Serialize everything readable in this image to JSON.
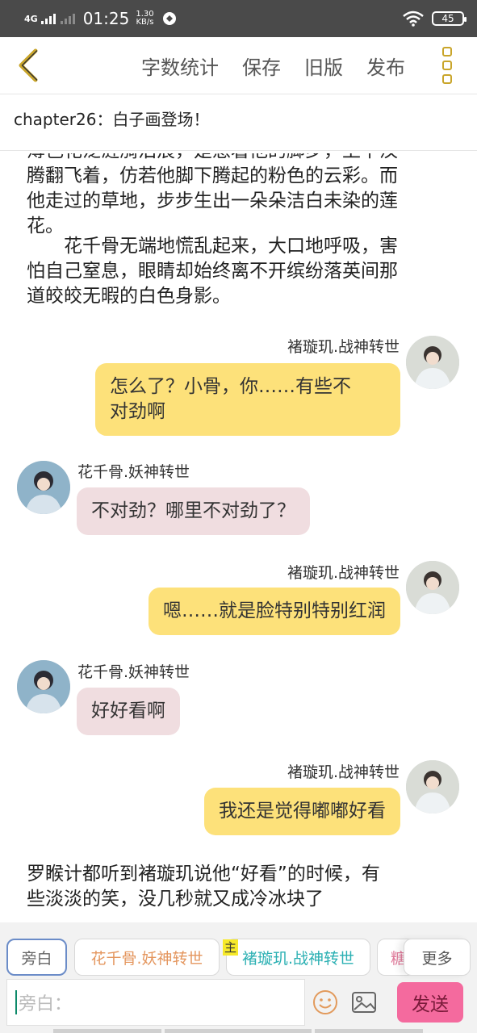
{
  "status_bar": {
    "network": "4G",
    "time": "01:25",
    "speed_value": "1.30",
    "speed_unit": "KB/s",
    "battery": "45"
  },
  "toolbar": {
    "word_count": "字数统计",
    "save": "保存",
    "old_version": "旧版",
    "publish": "发布",
    "back_icon": "chevron-left-icon",
    "more_icon": "more-vertical-icon"
  },
  "chapter": {
    "title": "chapter26：白子画登场！"
  },
  "story": {
    "para1_line1": "薄色花泛涟漪泪痕，是惹着他的脚步，上下汉",
    "para1_line2": "腾翻飞着，仿若他脚下腾起的粉色的云彩。而",
    "para1_line3": "他走过的草地，步步生出一朵朵洁白未染的莲",
    "para1_line4": "花。",
    "para2_line1": "　　花千骨无端地慌乱起来，大口地呼吸，害",
    "para2_line2": "怕自己窒息，眼睛却始终离不开缤纷落英间那",
    "para2_line3": "道皎皎无暇的白色身影。",
    "messages": [
      {
        "speaker": "褚璇玑.战神转世",
        "line1": "怎么了？小骨，你……有些不",
        "line2": "对劲啊"
      },
      {
        "speaker": "花千骨.妖神转世",
        "text": "不对劲？哪里不对劲了？"
      },
      {
        "speaker": "褚璇玑.战神转世",
        "text": "嗯……就是脸特别特别红润"
      },
      {
        "speaker": "花千骨.妖神转世",
        "text": "好好看啊"
      },
      {
        "speaker": "褚璇玑.战神转世",
        "text": "我还是觉得嘟嘟好看"
      }
    ],
    "para3_line1": "罗睺计都听到褚璇玑说他“好看”的时候，有",
    "para3_line2": "些淡淡的笑，没几秒就又成冷冰块了"
  },
  "roles": {
    "narration": "旁白",
    "role1": "花千骨.妖神转世",
    "main_tag": "主",
    "role2": "褚璇玑.战神转世",
    "role3": "糖",
    "more": "更多"
  },
  "input": {
    "placeholder": "旁白：",
    "send": "发送",
    "emoji_icon": "smile-icon",
    "image_icon": "image-icon"
  },
  "colors": {
    "right_bubble": "#fde17a",
    "left_bubble": "#f0dde0",
    "send_button": "#f46a9e",
    "accent_gold": "#c9a52a"
  }
}
